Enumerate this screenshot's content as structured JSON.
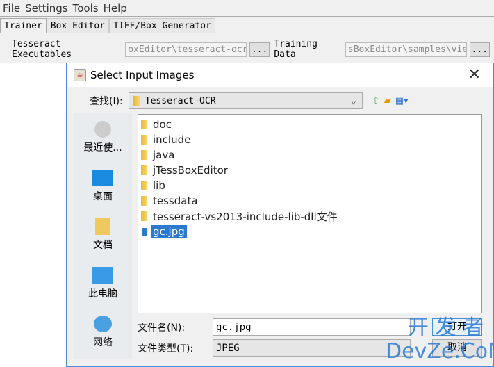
{
  "menu": [
    "File",
    "Settings",
    "Tools",
    "Help"
  ],
  "tabs": [
    "Trainer",
    "Box Editor",
    "TIFF/Box Generator"
  ],
  "toolbar": {
    "exec_label": "Tesseract Executables",
    "exec_value": "oxEditor\\tesseract-ocr",
    "browse": "...",
    "train_label": "Training Data",
    "train_value": "sBoxEditor\\samples\\vie"
  },
  "dialog": {
    "title": "Select Input Images",
    "look_in_label": "查找(I):",
    "look_in_value": "Tesseract-OCR",
    "places": [
      "最近使...",
      "桌面",
      "文档",
      "此电脑",
      "网络"
    ],
    "files": [
      "doc",
      "include",
      "java",
      "jTessBoxEditor",
      "lib",
      "tessdata",
      "tesseract-vs2013-include-lib-dll文件"
    ],
    "selected_file": "gc.jpg",
    "filename_label": "文件名(N):",
    "filename_value": "gc.jpg",
    "filetype_label": "文件类型(T):",
    "filetype_value": "JPEG",
    "open": "打开",
    "cancel": "取消"
  },
  "watermark": {
    "line1": "开 发 者",
    "line2": "DevZe.CoM"
  }
}
